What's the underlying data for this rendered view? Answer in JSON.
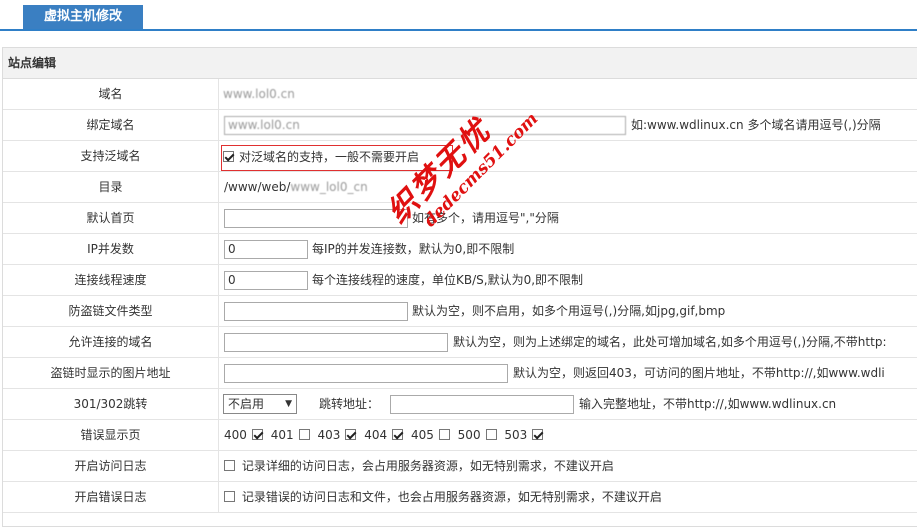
{
  "tab": {
    "title": "虚拟主机修改"
  },
  "section": {
    "title": "站点编辑"
  },
  "rows": {
    "domain": {
      "label": "域名",
      "value": "www.lol0.cn"
    },
    "bind_domain": {
      "label": "绑定域名",
      "value": "www.lol0.cn",
      "hint": "如:www.wdlinux.cn 多个域名请用逗号(,)分隔"
    },
    "wildcard": {
      "label": "支持泛域名",
      "checked": true,
      "text": "对泛域名的支持，一般不需要开启"
    },
    "dir": {
      "label": "目录",
      "prefix": "/www/web/",
      "blurred": "www_lol0_cn"
    },
    "index": {
      "label": "默认首页",
      "value": "",
      "hint": "如有多个，请用逗号\",\"分隔"
    },
    "ip_conn": {
      "label": "IP并发数",
      "value": "0",
      "hint": "每IP的并发连接数，默认为0,即不限制"
    },
    "speed": {
      "label": "连接线程速度",
      "value": "0",
      "hint": "每个连接线程的速度，单位KB/S,默认为0,即不限制"
    },
    "hotlink_types": {
      "label": "防盗链文件类型",
      "value": "",
      "hint": "默认为空，则不启用，如多个用逗号(,)分隔,如jpg,gif,bmp"
    },
    "allowed_domains": {
      "label": "允许连接的域名",
      "value": "",
      "hint": "默认为空，则为上述绑定的域名，此处可增加域名,如多个用逗号(,)分隔,不带http:"
    },
    "hotlink_image": {
      "label": "盗链时显示的图片地址",
      "value": "",
      "hint": "默认为空，则返回403，可访问的图片地址，不带http://,如www.wdli"
    },
    "redirect": {
      "label": "301/302跳转",
      "select": "不启用",
      "target_label": "跳转地址：",
      "target_value": "",
      "hint": "输入完整地址，不带http://,如www.wdlinux.cn"
    },
    "error_pages": {
      "label": "错误显示页",
      "codes": [
        {
          "code": "400",
          "checked": true
        },
        {
          "code": "401",
          "checked": false
        },
        {
          "code": "403",
          "checked": true
        },
        {
          "code": "404",
          "checked": true
        },
        {
          "code": "405",
          "checked": false
        },
        {
          "code": "500",
          "checked": false
        },
        {
          "code": "503",
          "checked": true
        }
      ]
    },
    "access_log": {
      "label": "开启访问日志",
      "checked": false,
      "text": "记录详细的访问日志，会占用服务器资源，如无特别需求，不建议开启"
    },
    "error_log": {
      "label": "开启错误日志",
      "checked": false,
      "text": "记录错误的访问日志和文件，也会占用服务器资源，如无特别需求，不建议开启"
    }
  },
  "watermark": {
    "line1": "织梦无忧",
    "line2": "dedecms51.com"
  }
}
